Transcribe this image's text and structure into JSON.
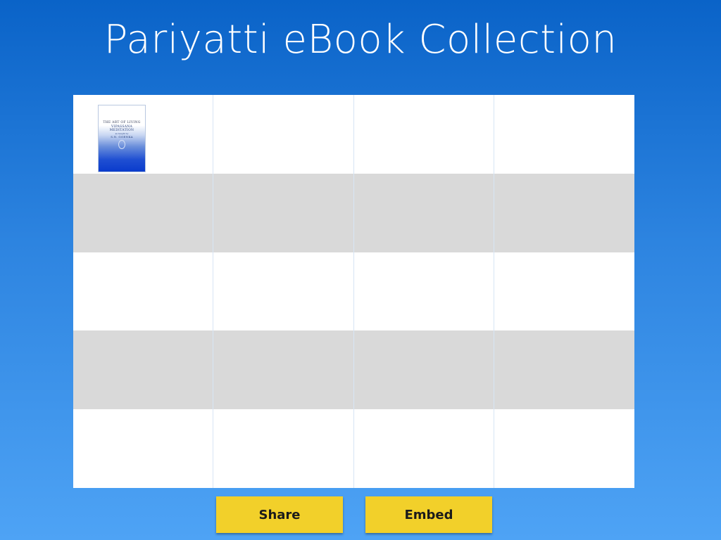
{
  "title": "Pariyatti eBook Collection",
  "shelf": {
    "columns": 4,
    "rows": 5,
    "row_colors": [
      "#ffffff",
      "#d9d9d9",
      "#ffffff",
      "#d9d9d9",
      "#ffffff"
    ],
    "books": [
      {
        "cover_title": "THE ART OF LIVING",
        "cover_line1": "VIPASSANA",
        "cover_line2": "MEDITATION",
        "cover_line3": "as taught by",
        "cover_author": "S.N. GOENKA",
        "cover_colors": [
          "#ffffff",
          "#1f4fd2"
        ]
      }
    ]
  },
  "actions": {
    "share_label": "Share",
    "embed_label": "Embed",
    "button_color": "#f2d02a"
  },
  "background": {
    "top_color": "#0a63c8",
    "bottom_color": "#4ea3f5"
  }
}
